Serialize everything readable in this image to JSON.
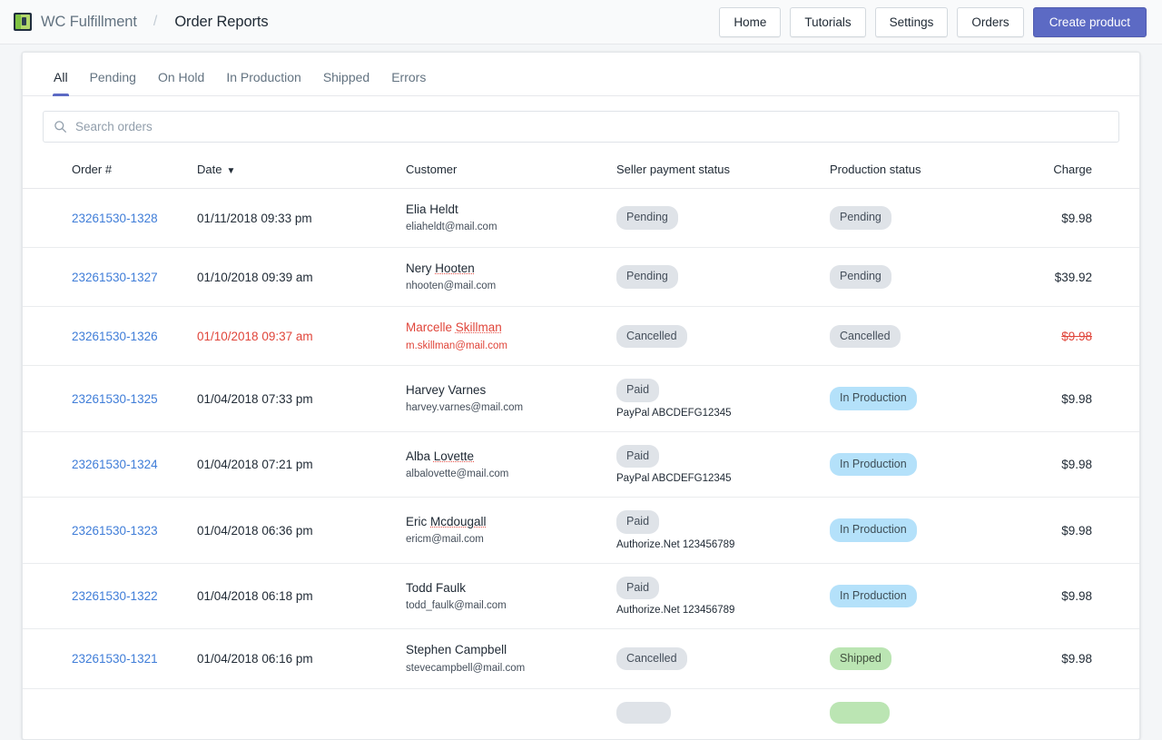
{
  "topbar": {
    "logo_icon": "app-logo-icon",
    "brand": "WC Fulfillment",
    "separator": "/",
    "page_title": "Order Reports",
    "buttons": [
      {
        "label": "Home",
        "style": "default"
      },
      {
        "label": "Tutorials",
        "style": "default"
      },
      {
        "label": "Settings",
        "style": "default"
      },
      {
        "label": "Orders",
        "style": "default"
      },
      {
        "label": "Create product",
        "style": "primary"
      }
    ]
  },
  "tabs": [
    {
      "label": "All",
      "active": true
    },
    {
      "label": "Pending",
      "active": false
    },
    {
      "label": "On Hold",
      "active": false
    },
    {
      "label": "In Production",
      "active": false
    },
    {
      "label": "Shipped",
      "active": false
    },
    {
      "label": "Errors",
      "active": false
    }
  ],
  "search": {
    "icon": "search-icon",
    "value": "",
    "placeholder": "Search orders"
  },
  "table": {
    "columns": [
      {
        "label": "Order #"
      },
      {
        "label": "Date",
        "sort_indicator": "▼",
        "sorted": "desc"
      },
      {
        "label": "Customer"
      },
      {
        "label": "Seller payment status"
      },
      {
        "label": "Production status"
      },
      {
        "label": "Charge"
      }
    ],
    "rows": [
      {
        "order": "23261530-1328",
        "date": "01/11/2018 09:33 pm",
        "customer_name": "Elia Heldt",
        "customer_email": "eliaheldt@mail.com",
        "payment_status": "Pending",
        "payment_badge": "default",
        "payment_sub": "",
        "production_status": "Pending",
        "production_badge": "default",
        "charge": "$9.98",
        "cancelled": false,
        "misspelled": ""
      },
      {
        "order": "23261530-1327",
        "date": "01/10/2018 09:39 am",
        "customer_name": "Nery Hooten",
        "customer_email": "nhooten@mail.com",
        "payment_status": "Pending",
        "payment_badge": "default",
        "payment_sub": "",
        "production_status": "Pending",
        "production_badge": "default",
        "charge": "$39.92",
        "cancelled": false,
        "misspelled": "Hooten"
      },
      {
        "order": "23261530-1326",
        "date": "01/10/2018 09:37 am",
        "customer_name": "Marcelle Skillman",
        "customer_email": "m.skillman@mail.com",
        "payment_status": "Cancelled",
        "payment_badge": "default",
        "payment_sub": "",
        "production_status": "Cancelled",
        "production_badge": "default",
        "charge": "$9.98",
        "cancelled": true,
        "misspelled": "Skillman"
      },
      {
        "order": "23261530-1325",
        "date": "01/04/2018 07:33 pm",
        "customer_name": "Harvey Varnes",
        "customer_email": "harvey.varnes@mail.com",
        "payment_status": "Paid",
        "payment_badge": "default",
        "payment_sub": "PayPal ABCDEFG12345",
        "production_status": "In Production",
        "production_badge": "info",
        "charge": "$9.98",
        "cancelled": false,
        "misspelled": ""
      },
      {
        "order": "23261530-1324",
        "date": "01/04/2018 07:21 pm",
        "customer_name": "Alba Lovette",
        "customer_email": "albalovette@mail.com",
        "payment_status": "Paid",
        "payment_badge": "default",
        "payment_sub": "PayPal ABCDEFG12345",
        "production_status": "In Production",
        "production_badge": "info",
        "charge": "$9.98",
        "cancelled": false,
        "misspelled": "Lovette"
      },
      {
        "order": "23261530-1323",
        "date": "01/04/2018 06:36 pm",
        "customer_name": "Eric Mcdougall",
        "customer_email": "ericm@mail.com",
        "payment_status": "Paid",
        "payment_badge": "default",
        "payment_sub": "Authorize.Net 123456789",
        "production_status": "In Production",
        "production_badge": "info",
        "charge": "$9.98",
        "cancelled": false,
        "misspelled": "Mcdougall"
      },
      {
        "order": "23261530-1322",
        "date": "01/04/2018 06:18 pm",
        "customer_name": "Todd Faulk",
        "customer_email": "todd_faulk@mail.com",
        "payment_status": "Paid",
        "payment_badge": "default",
        "payment_sub": "Authorize.Net 123456789",
        "production_status": "In Production",
        "production_badge": "info",
        "charge": "$9.98",
        "cancelled": false,
        "misspelled": ""
      },
      {
        "order": "23261530-1321",
        "date": "01/04/2018 06:16 pm",
        "customer_name": "Stephen Campbell",
        "customer_email": "stevecampbell@mail.com",
        "payment_status": "Cancelled",
        "payment_badge": "default",
        "payment_sub": "",
        "production_status": "Shipped",
        "production_badge": "success",
        "charge": "$9.98",
        "cancelled": false,
        "misspelled": ""
      },
      {
        "order": "",
        "date": "",
        "customer_name": "",
        "customer_email": "",
        "payment_status": "",
        "payment_badge": "default",
        "payment_sub": "",
        "production_status": "",
        "production_badge": "success",
        "charge": "",
        "cancelled": false,
        "misspelled": "",
        "clipped": true
      }
    ]
  },
  "colors": {
    "accent": "#5c6ac4",
    "link": "#3f7dd8",
    "danger": "#e0453a",
    "badge_default_bg": "#dfe3e8",
    "badge_info_bg": "#b4e1fa",
    "badge_success_bg": "#bbe5b3",
    "page_bg": "#f4f6f8",
    "topbar_bg": "#f9fafb"
  }
}
